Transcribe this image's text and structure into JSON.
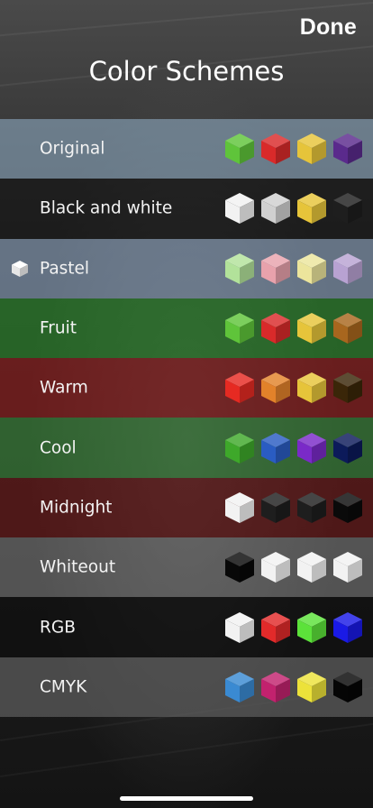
{
  "header": {
    "done_label": "Done",
    "title": "Color Schemes"
  },
  "selected_scheme": "Pastel",
  "schemes": [
    {
      "label": "Original",
      "row_color": "rgba(150,180,205,0.55)",
      "colors": [
        "#5fc43a",
        "#d92a2a",
        "#e6c43a",
        "#5a2a8c"
      ]
    },
    {
      "label": "Black and white",
      "row_color": "rgba(20,20,20,0.65)",
      "colors": [
        "#f2f2f2",
        "#d0d0d0",
        "#e6c43a",
        "#1e1e1e"
      ]
    },
    {
      "label": "Pastel",
      "row_color": "rgba(150,175,205,0.55)",
      "colors": [
        "#b2e29a",
        "#e8a2ac",
        "#ece59c",
        "#b8a2d2"
      ]
    },
    {
      "label": "Fruit",
      "row_color": "rgba(40,140,40,0.6)",
      "colors": [
        "#5fc43a",
        "#d92a2a",
        "#e6c43a",
        "#a8661e"
      ]
    },
    {
      "label": "Warm",
      "row_color": "rgba(150,25,25,0.6)",
      "colors": [
        "#e62a22",
        "#e2822a",
        "#e6c43a",
        "#3a2608"
      ]
    },
    {
      "label": "Cool",
      "row_color": "rgba(60,150,60,0.55)",
      "colors": [
        "#3ea82a",
        "#2a5cc2",
        "#7a2ac8",
        "#0c1a5a"
      ]
    },
    {
      "label": "Midnight",
      "row_color": "rgba(110,20,20,0.6)",
      "colors": [
        "#f2f2f2",
        "#1e1e1e",
        "#1e1e1e",
        "#0a0a0a"
      ]
    },
    {
      "label": "Whiteout",
      "row_color": "rgba(150,150,150,0.45)",
      "colors": [
        "#080808",
        "#f2f2f2",
        "#f2f2f2",
        "#f2f2f2"
      ]
    },
    {
      "label": "RGB",
      "row_color": "rgba(15,15,15,0.75)",
      "colors": [
        "#f2f2f2",
        "#e22a2a",
        "#5ce23a",
        "#1a1ae6"
      ]
    },
    {
      "label": "CMYK",
      "row_color": "rgba(95,95,95,0.7)",
      "colors": [
        "#3a8ad2",
        "#c2226e",
        "#ece23a",
        "#050505"
      ]
    }
  ]
}
